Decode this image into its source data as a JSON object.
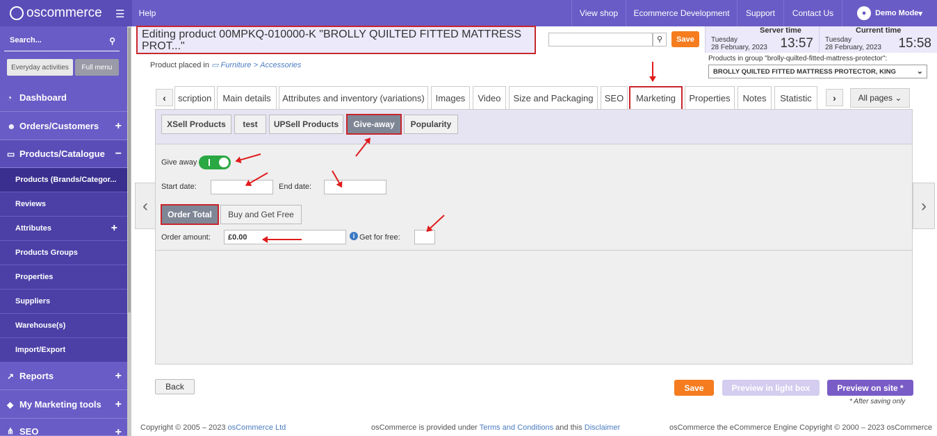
{
  "app": {
    "logo_text": "oscommerce",
    "help": "Help"
  },
  "topnav": [
    "View shop",
    "Ecommerce Development",
    "Support",
    "Contact Us"
  ],
  "user": {
    "name": "Demo Mode"
  },
  "sidebar": {
    "search_label": "Search...",
    "btn_everyday": "Everyday activities",
    "btn_full": "Full menu",
    "items": [
      {
        "label": "Dashboard",
        "icon": "dashboard-icon"
      },
      {
        "label": "Orders/Customers",
        "icon": "users-icon"
      },
      {
        "label": "Products/Catalogue",
        "icon": "folder-icon"
      }
    ],
    "subitems": [
      "Products (Brands/Categor...",
      "Reviews",
      "Attributes",
      "Products Groups",
      "Properties",
      "Suppliers",
      "Warehouse(s)",
      "Import/Export"
    ],
    "items2": [
      {
        "label": "Reports",
        "icon": "chart-icon"
      },
      {
        "label": "My Marketing tools",
        "icon": "tag-icon"
      },
      {
        "label": "SEO",
        "icon": "sitemap-icon"
      }
    ]
  },
  "header": {
    "title": "Editing product 00MPKQ-010000-K \"BROLLY QUILTED FITTED MATTRESS PROT...\"",
    "save": "Save",
    "server_time_label": "Server time",
    "server_day": "Tuesday",
    "server_date": "28 February, 2023",
    "server_time": "13:57",
    "current_time_label": "Current time",
    "current_day": "Tuesday",
    "current_date": "28 February, 2023",
    "current_time": "15:58"
  },
  "placed": {
    "prefix": "Product placed in",
    "cat1": "Furniture",
    "sep": ">",
    "cat2": "Accessories"
  },
  "group": {
    "label": "Products in group \"brolly-quilted-fitted-mattress-protector\":",
    "value": "BROLLY QUILTED FITTED MATTRESS PROTECTOR, KING"
  },
  "tabs": [
    "scription",
    "Main details",
    "Attributes and inventory (variations)",
    "Images",
    "Video",
    "Size and Packaging",
    "SEO",
    "Marketing",
    "Properties",
    "Notes",
    "Statistic"
  ],
  "all_pages": "All pages",
  "subtabs": [
    "XSell Products",
    "test",
    "UPSell Products",
    "Give-away",
    "Popularity"
  ],
  "giveaway": {
    "give_away_label": "Give away",
    "start_date_label": "Start date:",
    "end_date_label": "End date:",
    "order_total": "Order Total",
    "buy_get_free": "Buy and Get Free",
    "order_amount_label": "Order amount:",
    "order_amount_value": "£0.00",
    "get_for_free_label": "Get for free:"
  },
  "bottom": {
    "back": "Back",
    "save": "Save",
    "preview_lightbox": "Preview in light box",
    "preview_site": "Preview on site *",
    "after_saving": "* After saving only"
  },
  "footer": {
    "copyright": "Copyright © 2005 – 2023",
    "company": "osCommerce Ltd",
    "provided": "osCommerce is provided under",
    "terms": "Terms and Conditions",
    "and_this": "and this",
    "disclaimer": "Disclaimer",
    "engine": "osCommerce the eCommerce Engine Copyright © 2000 – 2023 osCommerce"
  },
  "colors": {
    "brand": "#6a5cc6",
    "accent": "#f57c1f",
    "highlight": "#c8262c",
    "toggle_on": "#2aa843"
  }
}
